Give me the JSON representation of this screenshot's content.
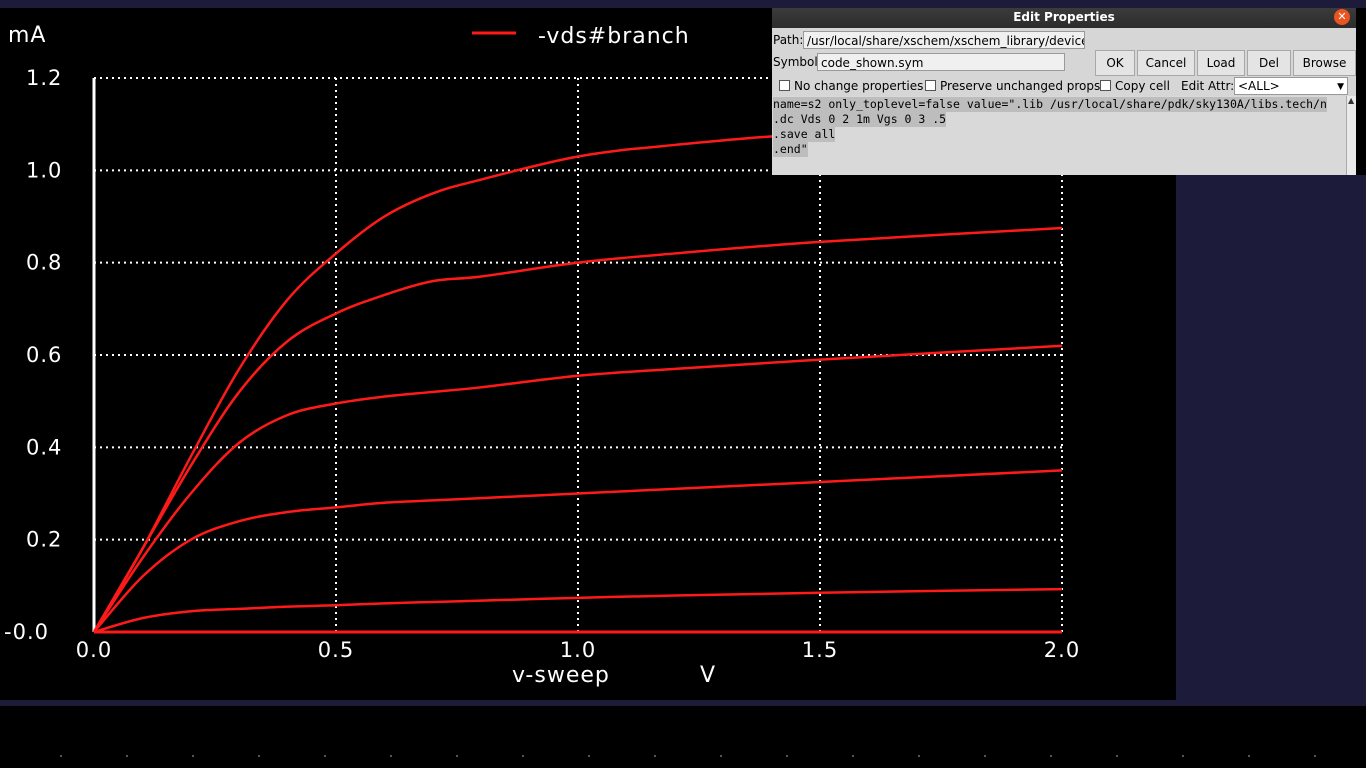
{
  "plot": {
    "y_unit": "mA",
    "legend": "-vds#branch",
    "x_label": "v-sweep",
    "x_unit": "V",
    "y_ticks": [
      "1.2",
      "1.0",
      "0.8",
      "0.6",
      "0.4",
      "0.2",
      "-0.0"
    ],
    "x_ticks": [
      "0.0",
      "0.5",
      "1.0",
      "1.5",
      "2.0"
    ],
    "colors": {
      "trace": "#ff1a1a",
      "grid": "#ffffff",
      "background": "#000000"
    }
  },
  "chart_data": {
    "type": "line",
    "xlabel": "v-sweep",
    "xunit": "V",
    "ylabel": "mA",
    "xlim": [
      0,
      2.0
    ],
    "ylim": [
      0,
      1.2
    ],
    "x": [
      0,
      0.1,
      0.2,
      0.3,
      0.4,
      0.5,
      0.6,
      0.7,
      0.8,
      1.0,
      1.2,
      1.5,
      2.0
    ],
    "series": [
      {
        "name": "-vds#branch",
        "values": [
          0,
          0.03,
          0.045,
          0.05,
          0.055,
          0.058,
          0.062,
          0.065,
          0.068,
          0.074,
          0.079,
          0.085,
          0.093
        ]
      },
      {
        "values": [
          0,
          0.12,
          0.2,
          0.24,
          0.26,
          0.27,
          0.28,
          0.285,
          0.29,
          0.3,
          0.31,
          0.325,
          0.35
        ]
      },
      {
        "values": [
          0,
          0.16,
          0.3,
          0.41,
          0.47,
          0.495,
          0.51,
          0.52,
          0.53,
          0.555,
          0.57,
          0.59,
          0.62
        ]
      },
      {
        "values": [
          0,
          0.18,
          0.36,
          0.52,
          0.63,
          0.69,
          0.73,
          0.76,
          0.77,
          0.8,
          0.82,
          0.845,
          0.875
        ]
      },
      {
        "values": [
          0,
          0.18,
          0.38,
          0.57,
          0.72,
          0.82,
          0.9,
          0.95,
          0.98,
          1.03,
          1.055,
          1.08,
          1.1
        ]
      }
    ]
  },
  "dialog": {
    "title": "Edit Properties",
    "path_label": "Path:",
    "path_value": "/usr/local/share/xschem/xschem_library/devices",
    "symbol_label": "Symbol",
    "symbol_value": "code_shown.sym",
    "buttons": {
      "ok": "OK",
      "cancel": "Cancel",
      "load": "Load",
      "del": "Del",
      "browse": "Browse"
    },
    "checkboxes": {
      "no_change": "No change properties",
      "preserve": "Preserve unchanged props",
      "copy_cell": "Copy cell"
    },
    "edit_attr_label": "Edit Attr:",
    "edit_attr_value": "<ALL>",
    "text_lines": [
      "name=s2 only_toplevel=false value=\".lib /usr/local/share/pdk/sky130A/libs.tech/n",
      ".dc Vds 0 2 1m Vgs 0 3 .5",
      ".save all",
      ".end\""
    ]
  }
}
